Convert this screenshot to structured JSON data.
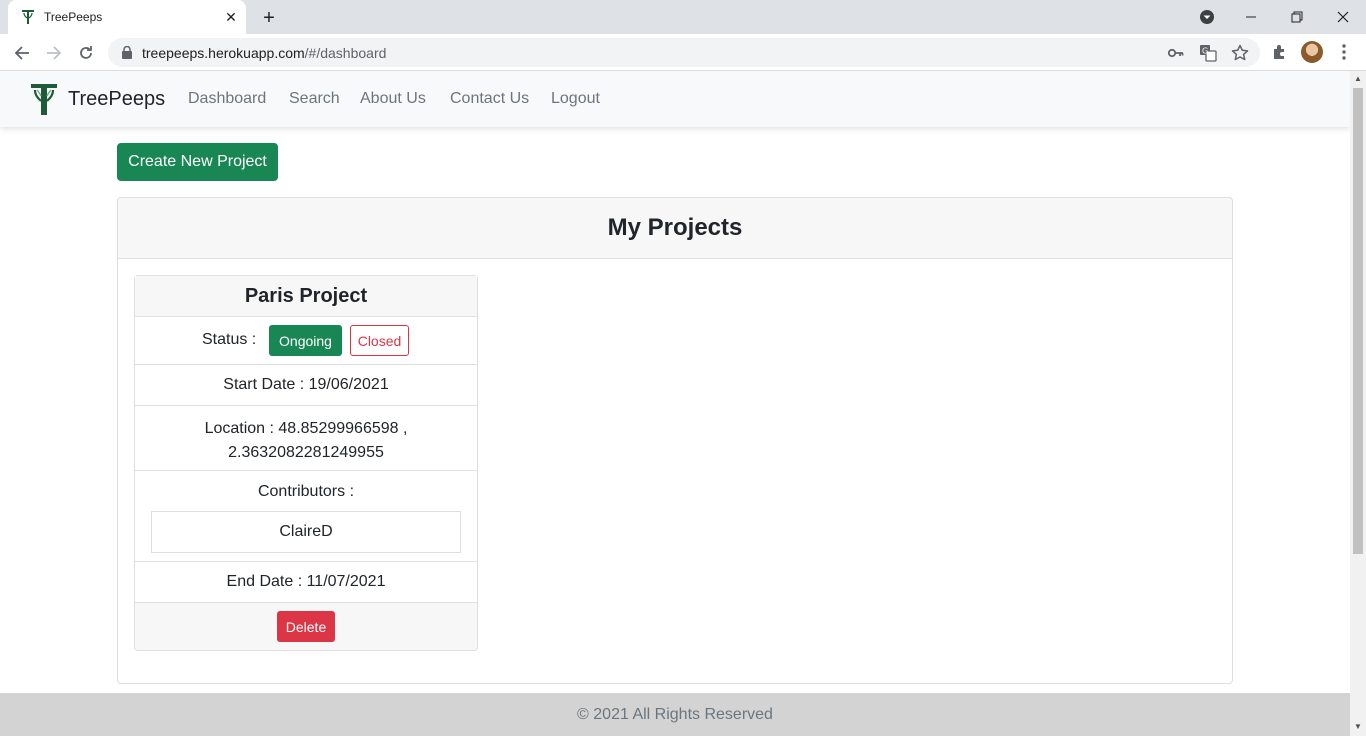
{
  "browser": {
    "tab_title": "TreePeeps",
    "url_host": "treepeeps.herokuapp.com",
    "url_path": "/#/dashboard"
  },
  "navbar": {
    "brand": "TreePeeps",
    "links": [
      "Dashboard",
      "Search",
      "About Us",
      "Contact Us",
      "Logout"
    ]
  },
  "actions": {
    "create_label": "Create New Project"
  },
  "projects_panel": {
    "title": "My Projects",
    "projects": [
      {
        "name": "Paris Project",
        "status_label": "Status :",
        "status_ongoing": "Ongoing",
        "status_closed": "Closed",
        "start_date": "Start Date : 19/06/2021",
        "location_line1": "Location : 48.85299966598 ,",
        "location_line2": "2.3632082281249955",
        "contributors_label": "Contributors :",
        "contributors": [
          "ClaireD"
        ],
        "end_date": "End Date : 11/07/2021",
        "delete_label": "Delete"
      }
    ]
  },
  "footer": {
    "text": "© 2021 All Rights Reserved"
  },
  "colors": {
    "success": "#198754",
    "danger": "#dc3545",
    "navbar_bg": "#f8f9fa",
    "footer_bg": "#d3d3d3"
  }
}
